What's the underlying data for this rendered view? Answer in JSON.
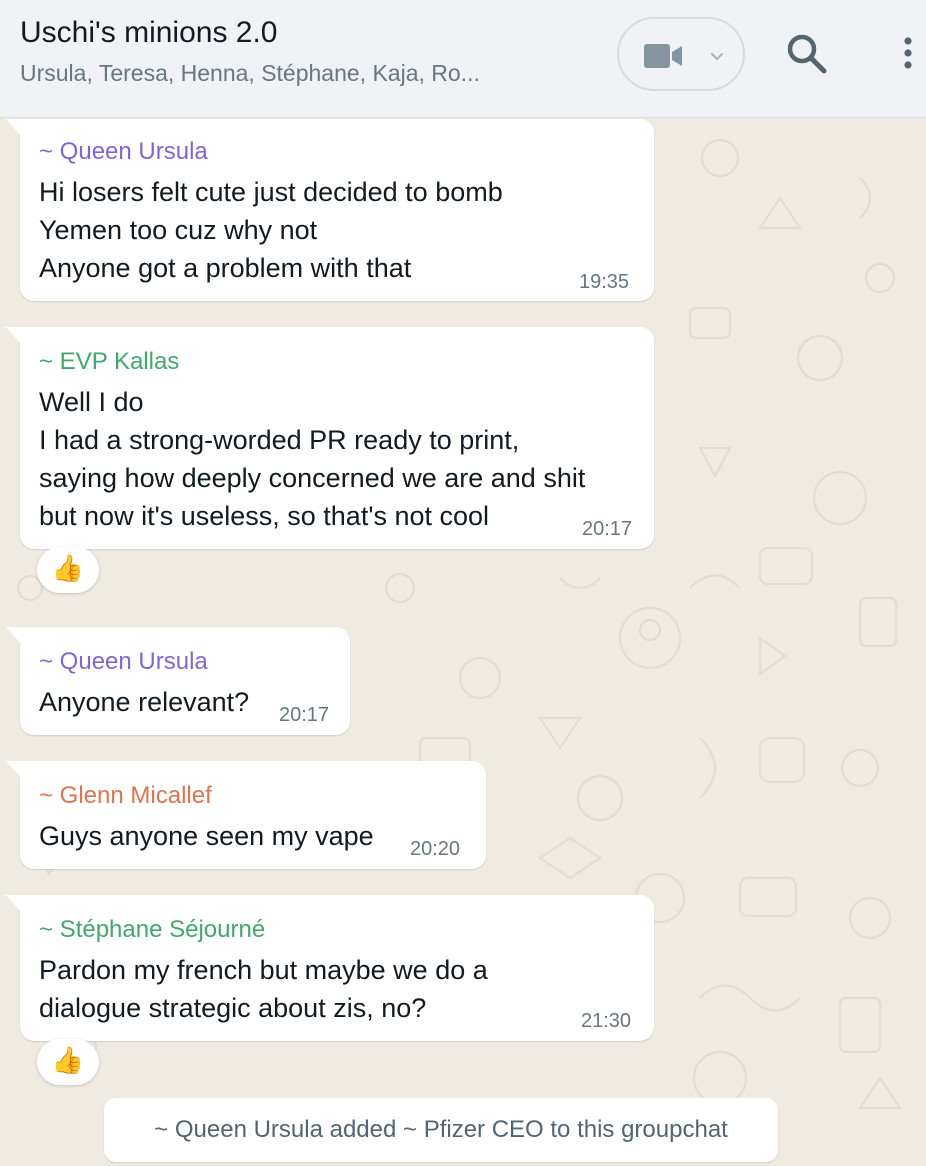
{
  "header": {
    "title": "Uschi's minions 2.0",
    "members": "Ursula, Teresa, Henna, Stéphane, Kaja, Ro...",
    "video_icon": "video-camera-icon",
    "dropdown_icon": "chevron-down-icon",
    "search_icon": "search-icon",
    "menu_icon": "more-vertical-icon"
  },
  "colors": {
    "sender_purple": "#7f66d8",
    "sender_green": "#3fa96a",
    "sender_orange": "#e3734a",
    "chat_background": "#efeae2"
  },
  "messages": [
    {
      "sender": "~ Queen Ursula",
      "lines": [
        "Hi losers felt cute just decided to bomb",
        "Yemen too cuz why not",
        "Anyone got a problem with that"
      ],
      "time": "19:35"
    },
    {
      "sender": "~ EVP Kallas",
      "lines": [
        "Well I do",
        "I had a strong-worded PR ready to print,",
        "saying how deeply concerned we are and shit",
        "but now it's useless, so that's not cool"
      ],
      "time": "20:17",
      "reaction": "👍"
    },
    {
      "sender": "~ Queen Ursula",
      "lines": [
        "Anyone relevant?"
      ],
      "time": "20:17"
    },
    {
      "sender": "~ Glenn Micallef",
      "lines": [
        "Guys anyone seen my vape"
      ],
      "time": "20:20"
    },
    {
      "sender": "~ Stéphane Séjourné",
      "lines": [
        "Pardon my french but maybe we do a",
        "dialogue strategic about zis, no?"
      ],
      "time": "21:30",
      "reaction": "👍"
    }
  ],
  "system_message": "~ Queen Ursula added ~ Pfizer CEO to this groupchat"
}
